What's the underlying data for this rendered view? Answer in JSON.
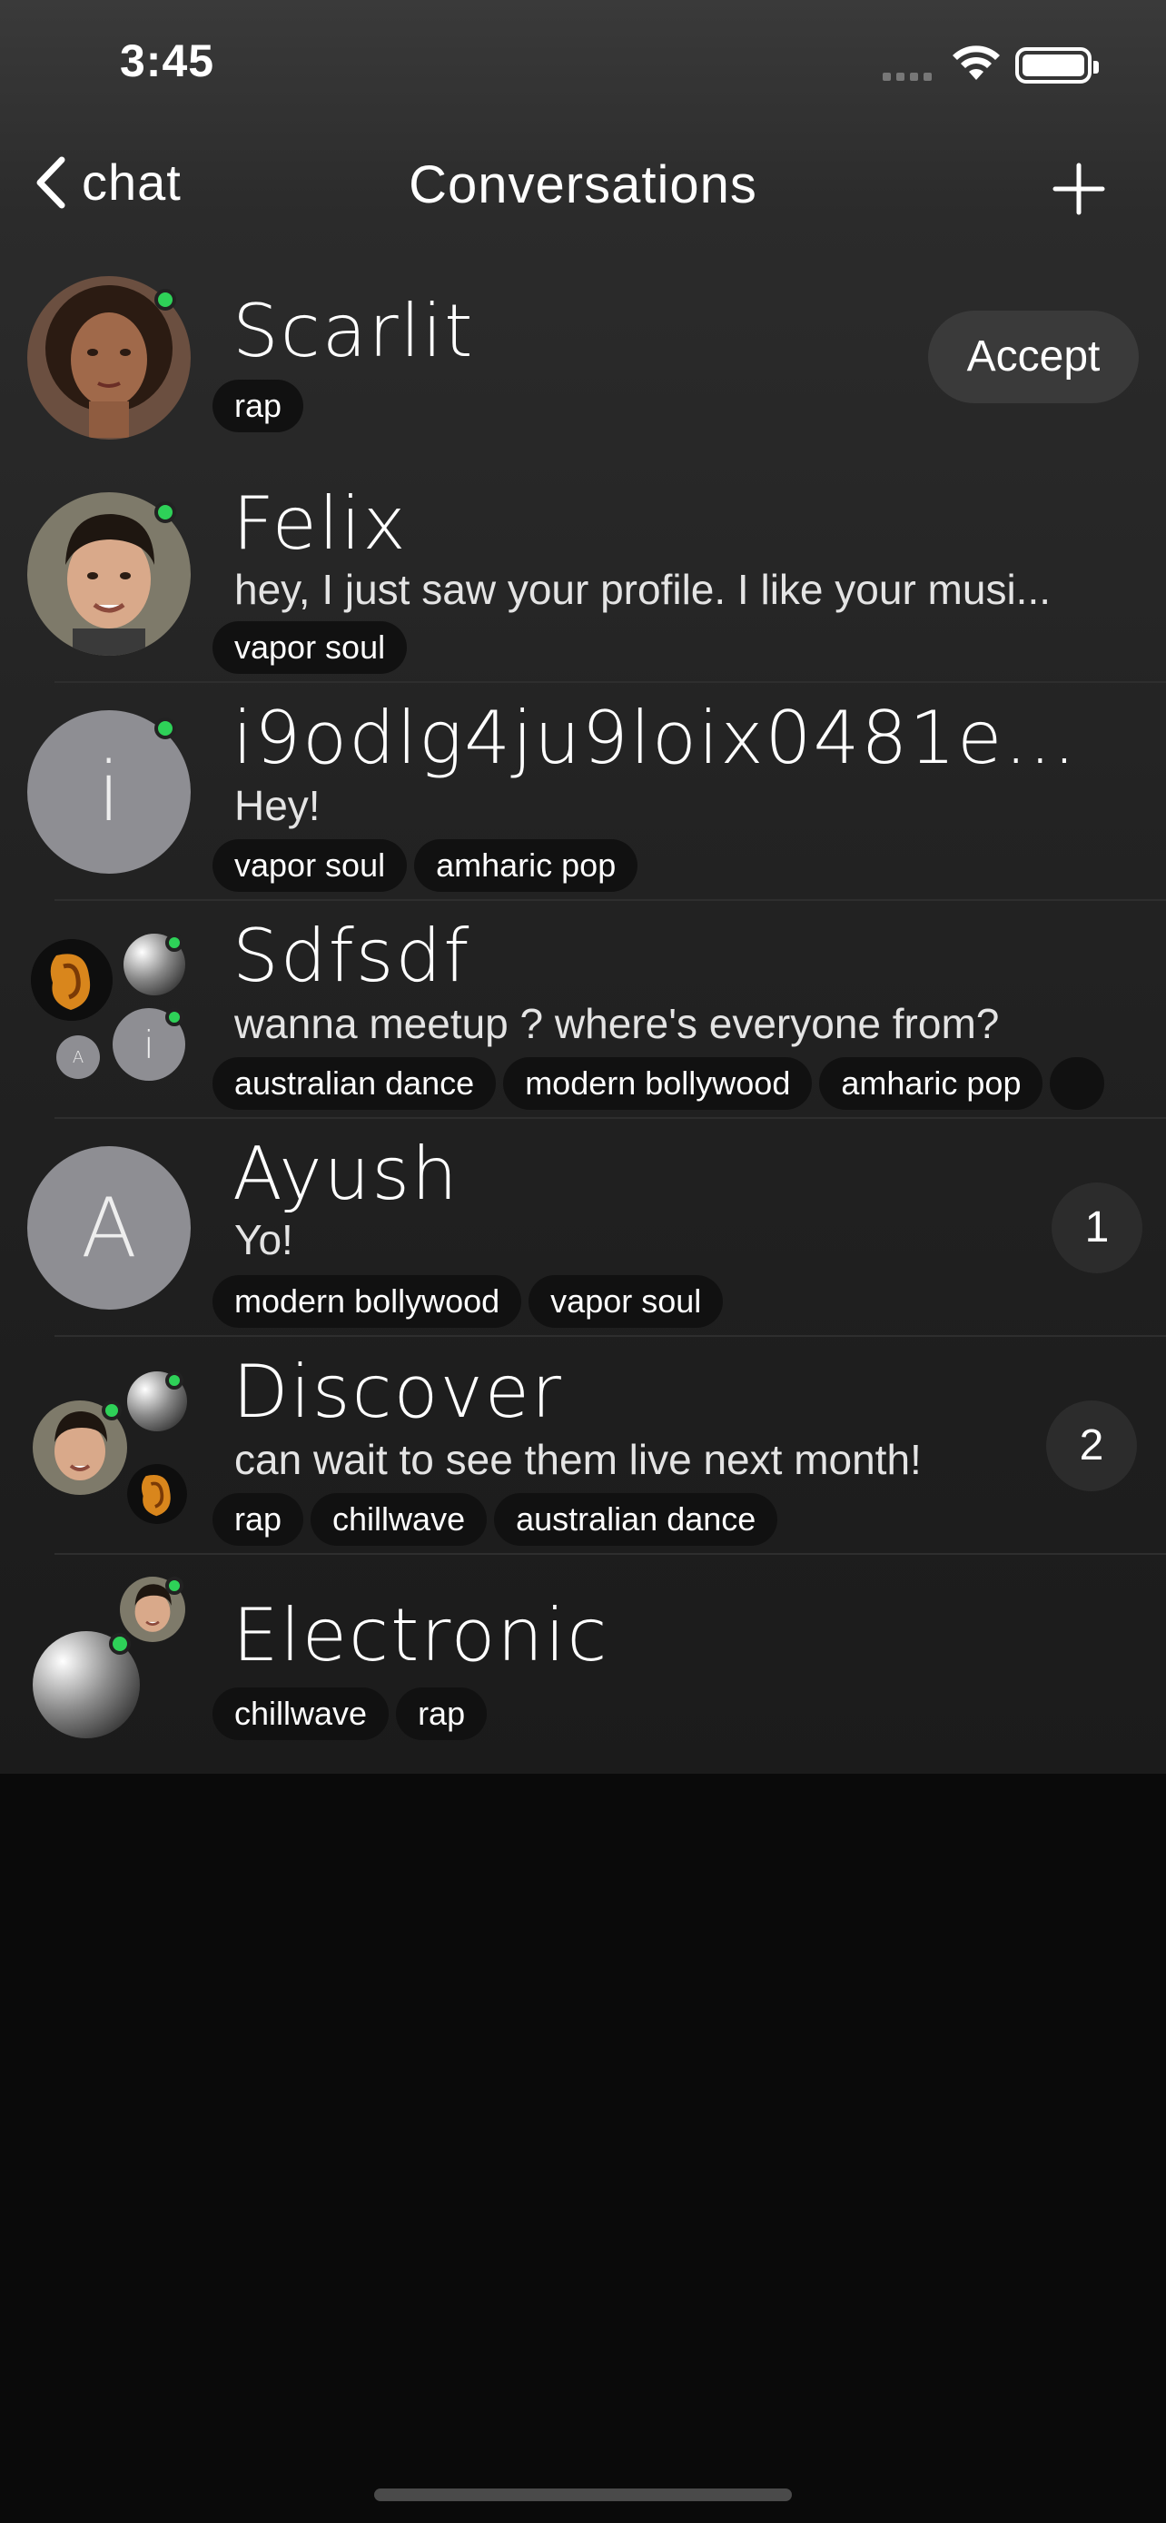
{
  "status_bar": {
    "time": "3:45"
  },
  "nav": {
    "back_label": "chat",
    "title": "Conversations"
  },
  "conversations": [
    {
      "name": "Scarlit",
      "preview": "",
      "tags": [
        "rap"
      ],
      "action_label": "Accept",
      "online": true
    },
    {
      "name": "Felix",
      "preview": "hey, I just saw your profile. I like your musi...",
      "tags": [
        "vapor soul"
      ],
      "online": true
    },
    {
      "name": "i9odlg4ju9loix0481ec8...",
      "avatar_letter": "i",
      "preview": "Hey!",
      "tags": [
        "vapor soul",
        "amharic pop"
      ],
      "online": true
    },
    {
      "name": "Sdfsdf",
      "preview": "wanna meetup ? where's everyone from?",
      "tags": [
        "australian dance",
        "modern bollywood",
        "amharic pop"
      ],
      "group_letters": [
        "i",
        "A"
      ]
    },
    {
      "name": "Ayush",
      "avatar_letter": "A",
      "preview": "Yo!",
      "tags": [
        "modern bollywood",
        "vapor soul"
      ],
      "unread": "1"
    },
    {
      "name": "Discover",
      "preview": "can wait to see them live next month!",
      "tags": [
        "rap",
        "chillwave",
        "australian dance"
      ],
      "unread": "2"
    },
    {
      "name": "Electronic",
      "preview": "",
      "tags": [
        "chillwave",
        "rap"
      ]
    }
  ],
  "colors": {
    "online": "#2ed158",
    "background": "#0a0a0a",
    "tag_bg": "#111111"
  }
}
